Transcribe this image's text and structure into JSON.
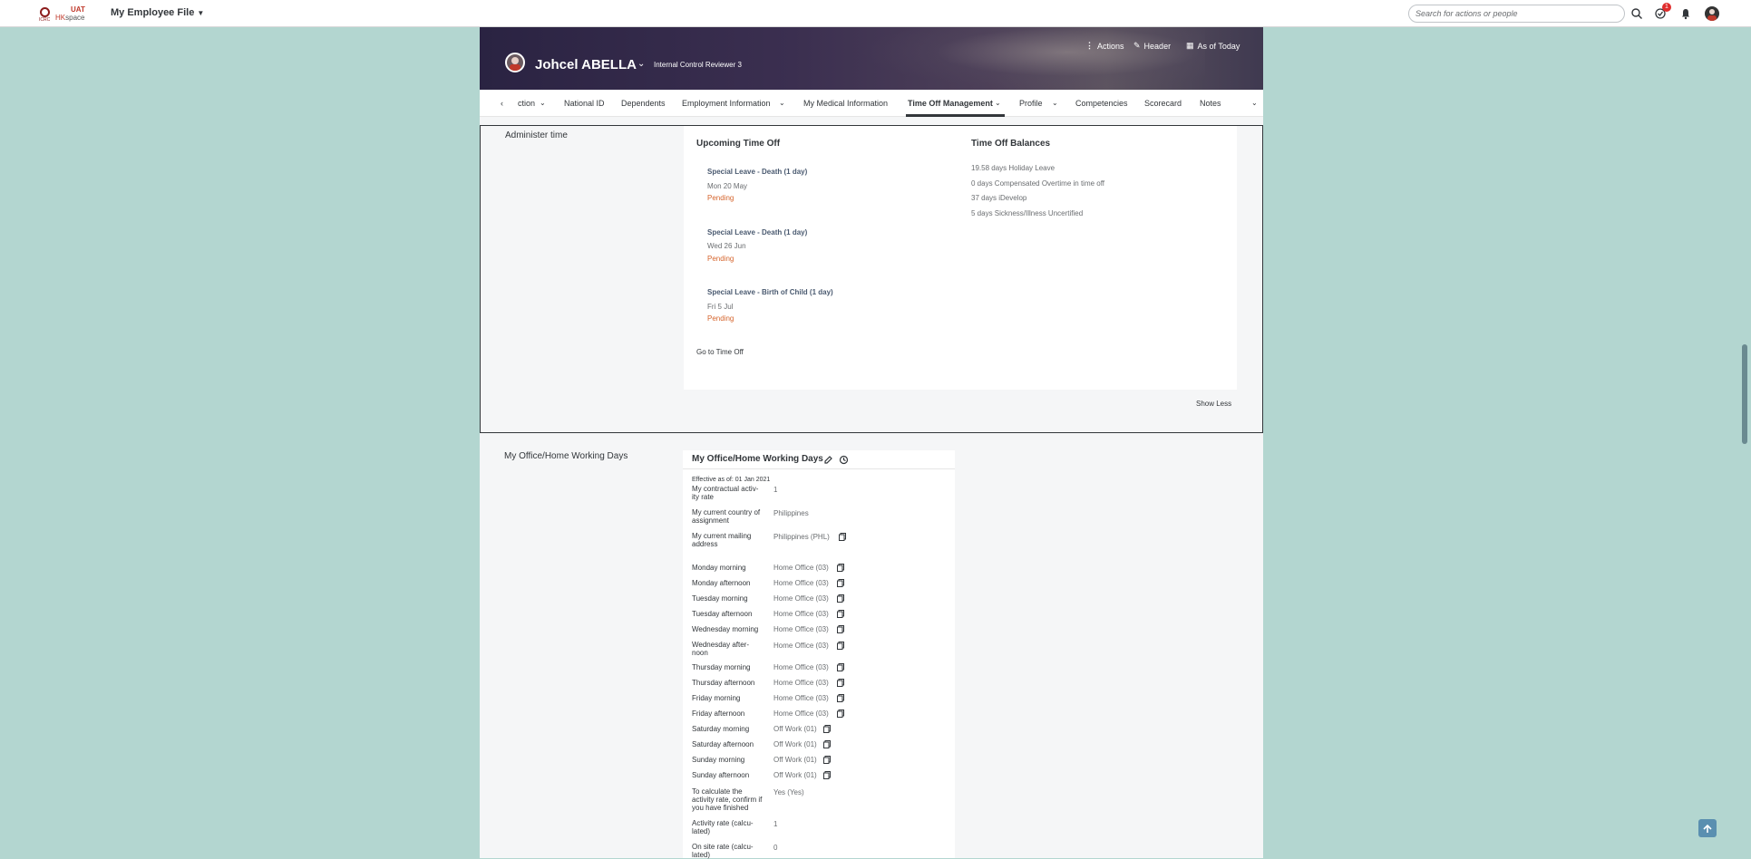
{
  "shell": {
    "logo_uat": "UAT",
    "logo_hk": "HK",
    "logo_space": "space",
    "logo_sub": "ICRC",
    "app_title": "My Employee File",
    "search_placeholder": "Search for actions or people",
    "notification_count": "1"
  },
  "header": {
    "name": "Johcel ABELLA",
    "role": "Internal Control Reviewer 3",
    "actions_label": "Actions",
    "header_label": "Header",
    "as_of_label": "As of Today"
  },
  "tabs": [
    {
      "label": "ction"
    },
    {
      "label": "National ID"
    },
    {
      "label": "Dependents"
    },
    {
      "label": "Employment Information"
    },
    {
      "label": "My Medical Information"
    },
    {
      "label": "Time Off Management"
    },
    {
      "label": "Profile"
    },
    {
      "label": "Competencies"
    },
    {
      "label": "Scorecard"
    },
    {
      "label": "Notes"
    }
  ],
  "admin": {
    "section_label": "Administer time",
    "upcoming_title": "Upcoming Time Off",
    "upcoming": [
      {
        "title": "Special Leave - Death (1 day)",
        "date": "Mon 20 May",
        "status": "Pending"
      },
      {
        "title": "Special Leave - Death (1 day)",
        "date": "Wed 26 Jun",
        "status": "Pending"
      },
      {
        "title": "Special Leave - Birth of Child (1 day)",
        "date": "Fri 5 Jul",
        "status": "Pending"
      }
    ],
    "go_to_time_off": "Go to Time Off",
    "balances_title": "Time Off Balances",
    "balances": [
      "19.58 days Holiday Leave",
      "0 days Compensated Overtime in time off",
      "37 days iDevelop",
      "5 days Sickness/Illness Uncertified"
    ],
    "show_less": "Show Less"
  },
  "office": {
    "section_label": "My Office/Home Working Days",
    "card_title": "My Office/Home Working Days",
    "effective": "Effective as of: 01 Jan 2021",
    "rows": [
      {
        "label": "My contractual activ-ity rate",
        "value": "1"
      },
      {
        "label": "My current country of assignment",
        "value": "Philippines"
      },
      {
        "label": "My current mailing address",
        "value": "Philippines (PHL)"
      },
      {
        "label": "Monday morning",
        "value": "Home Office (03)"
      },
      {
        "label": "Monday afternoon",
        "value": "Home Office (03)"
      },
      {
        "label": "Tuesday morning",
        "value": "Home Office (03)"
      },
      {
        "label": "Tuesday afternoon",
        "value": "Home Office (03)"
      },
      {
        "label": "Wednesday morning",
        "value": "Home Office (03)"
      },
      {
        "label": "Wednesday after-noon",
        "value": "Home Office (03)"
      },
      {
        "label": "Thursday morning",
        "value": "Home Office (03)"
      },
      {
        "label": "Thursday afternoon",
        "value": "Home Office (03)"
      },
      {
        "label": "Friday morning",
        "value": "Home Office (03)"
      },
      {
        "label": "Friday afternoon",
        "value": "Home Office (03)"
      },
      {
        "label": "Saturday morning",
        "value": "Off Work (01)"
      },
      {
        "label": "Saturday afternoon",
        "value": "Off Work (01)"
      },
      {
        "label": "Sunday morning",
        "value": "Off Work (01)"
      },
      {
        "label": "Sunday afternoon",
        "value": "Off Work (01)"
      },
      {
        "label": "To calculate the activity rate, confirm if you have finished",
        "value": "Yes (Yes)"
      },
      {
        "label": "Activity rate (calcu-lated)",
        "value": "1"
      },
      {
        "label": "On site rate (calcu-lated)",
        "value": "0"
      }
    ]
  }
}
